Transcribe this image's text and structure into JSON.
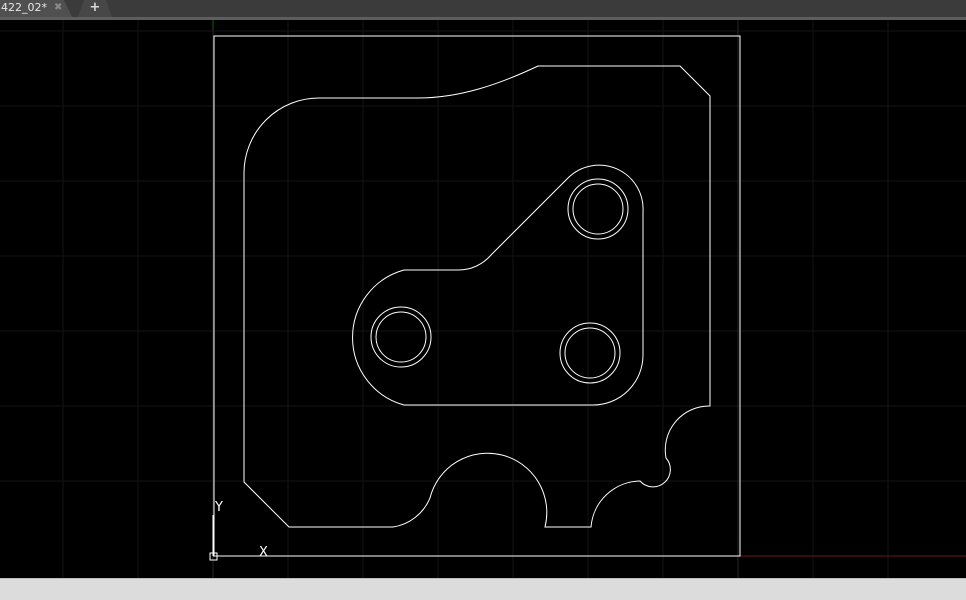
{
  "tabs": [
    {
      "label": "422_02*",
      "close_glyph": "✖"
    }
  ],
  "new_tab_glyph": "+",
  "ucs": {
    "x_label": "X",
    "y_label": "Y"
  },
  "colors": {
    "background": "#000000",
    "geometry": "#ffffff",
    "grid_minor": "#141414",
    "grid_major": "#262626",
    "x_axis": "#7a1818"
  },
  "status": {}
}
